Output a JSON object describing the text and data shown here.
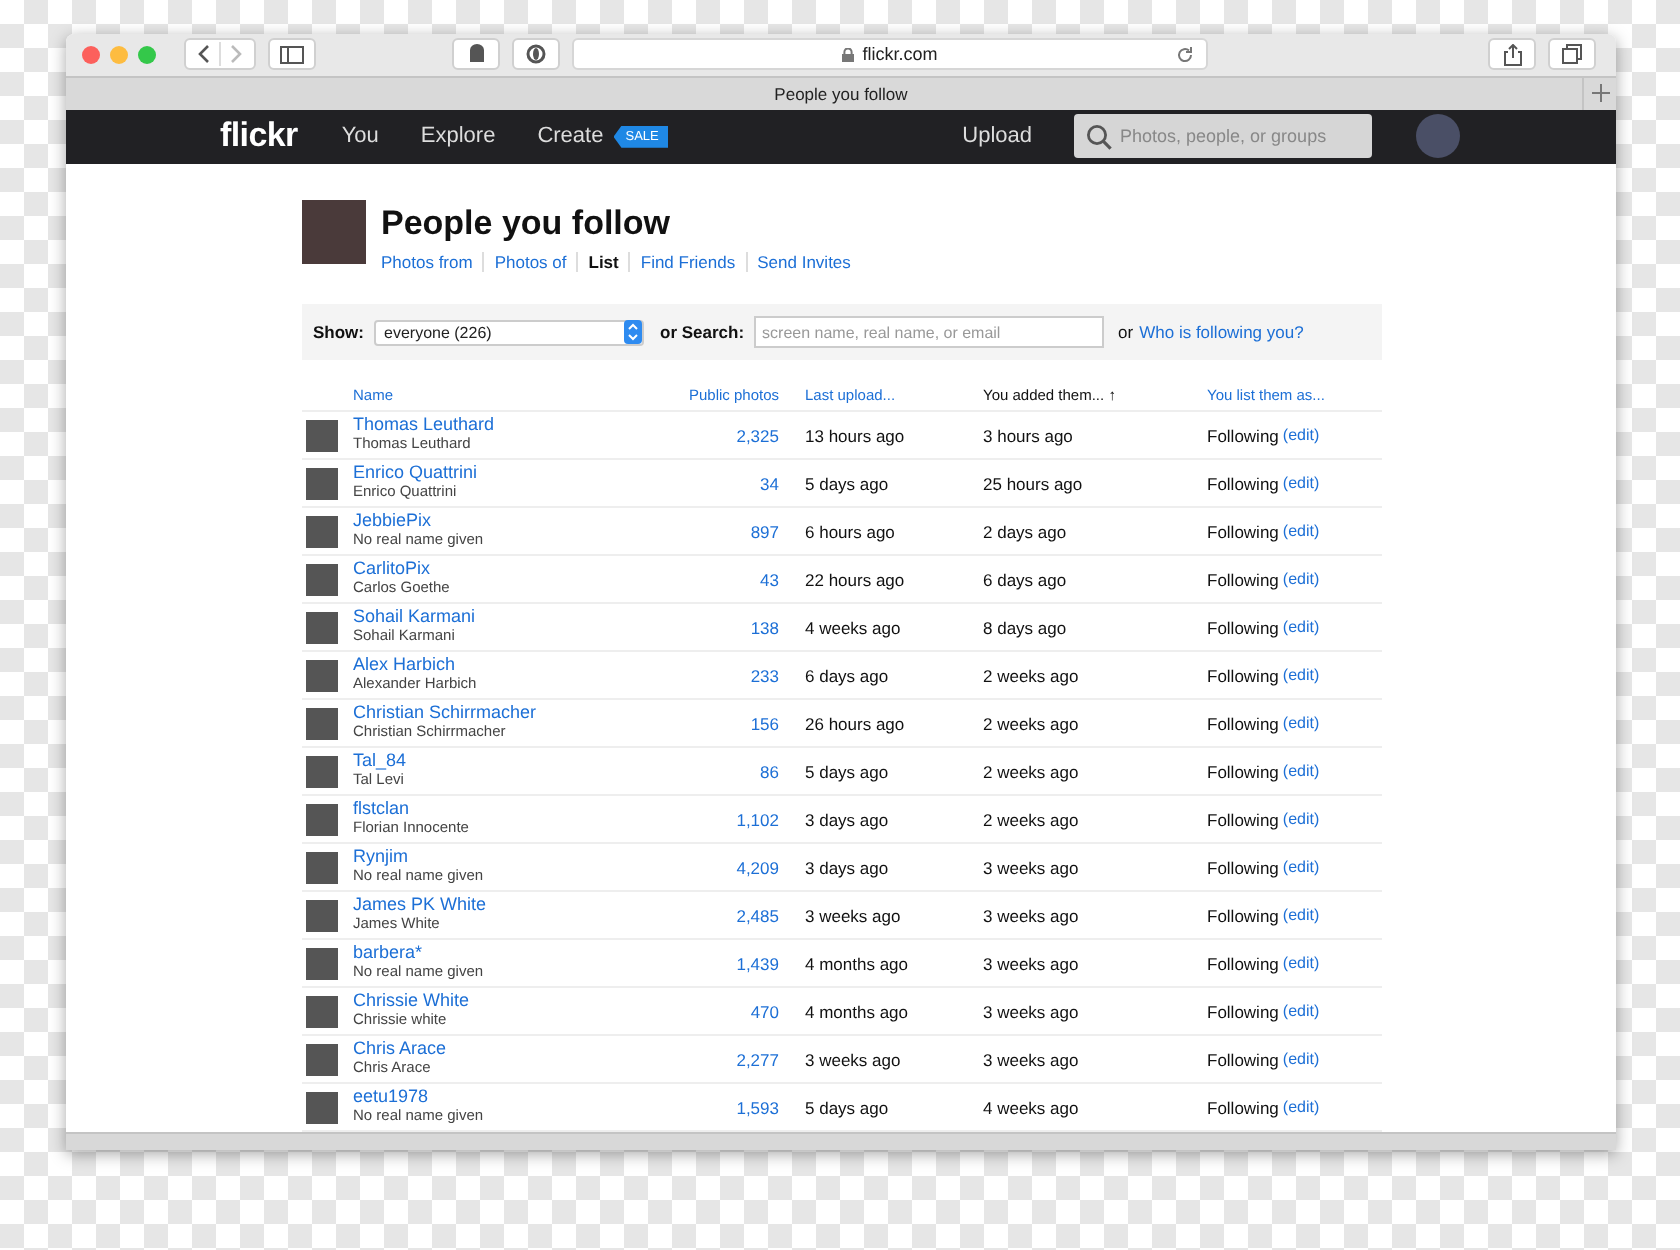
{
  "browser": {
    "url": "flickr.com",
    "tab_title": "People you follow"
  },
  "nav": {
    "logo": "flickr",
    "links": [
      "You",
      "Explore",
      "Create"
    ],
    "badge": "SALE",
    "upload": "Upload",
    "search_placeholder": "Photos, people, or groups"
  },
  "page": {
    "title": "People you follow",
    "tabs": [
      {
        "label": "Photos from",
        "selected": false
      },
      {
        "label": "Photos of",
        "selected": false
      },
      {
        "label": "List",
        "selected": true
      },
      {
        "label": "Find Friends",
        "selected": false
      },
      {
        "label": "Send Invites",
        "selected": false
      }
    ]
  },
  "filter": {
    "show_label": "Show:",
    "select_value": "everyone (226)",
    "search_label": "or Search:",
    "search_placeholder": "screen name, real name, or email",
    "or_text": "or",
    "who_link": "Who is following you?"
  },
  "table": {
    "columns": [
      {
        "label": "Name",
        "selected": false
      },
      {
        "label": "Public photos",
        "selected": false
      },
      {
        "label": "Last upload...",
        "selected": false
      },
      {
        "label": "You added them... ↑",
        "selected": true
      },
      {
        "label": "You list them as...",
        "selected": false
      }
    ],
    "rows": [
      {
        "screen_name": "Thomas Leuthard",
        "real_name": "Thomas Leuthard",
        "photos": "2,325",
        "last_upload": "13 hours ago",
        "added": "3 hours ago",
        "status": "Following",
        "edit": "(edit)"
      },
      {
        "screen_name": "Enrico Quattrini",
        "real_name": "Enrico Quattrini",
        "photos": "34",
        "last_upload": "5 days ago",
        "added": "25 hours ago",
        "status": "Following",
        "edit": "(edit)"
      },
      {
        "screen_name": "JebbiePix",
        "real_name": "No real name given",
        "photos": "897",
        "last_upload": "6 hours ago",
        "added": "2 days ago",
        "status": "Following",
        "edit": "(edit)"
      },
      {
        "screen_name": "CarlitoPix",
        "real_name": "Carlos Goethe",
        "photos": "43",
        "last_upload": "22 hours ago",
        "added": "6 days ago",
        "status": "Following",
        "edit": "(edit)"
      },
      {
        "screen_name": "Sohail Karmani",
        "real_name": "Sohail Karmani",
        "photos": "138",
        "last_upload": "4 weeks ago",
        "added": "8 days ago",
        "status": "Following",
        "edit": "(edit)"
      },
      {
        "screen_name": "Alex Harbich",
        "real_name": "Alexander Harbich",
        "photos": "233",
        "last_upload": "6 days ago",
        "added": "2 weeks ago",
        "status": "Following",
        "edit": "(edit)"
      },
      {
        "screen_name": "Christian Schirrmacher",
        "real_name": "Christian Schirrmacher",
        "photos": "156",
        "last_upload": "26 hours ago",
        "added": "2 weeks ago",
        "status": "Following",
        "edit": "(edit)"
      },
      {
        "screen_name": "Tal_84",
        "real_name": "Tal Levi",
        "photos": "86",
        "last_upload": "5 days ago",
        "added": "2 weeks ago",
        "status": "Following",
        "edit": "(edit)"
      },
      {
        "screen_name": "flstclan",
        "real_name": "Florian Innocente",
        "photos": "1,102",
        "last_upload": "3 days ago",
        "added": "2 weeks ago",
        "status": "Following",
        "edit": "(edit)"
      },
      {
        "screen_name": "Rynjim",
        "real_name": "No real name given",
        "photos": "4,209",
        "last_upload": "3 days ago",
        "added": "3 weeks ago",
        "status": "Following",
        "edit": "(edit)"
      },
      {
        "screen_name": "James PK White",
        "real_name": "James White",
        "photos": "2,485",
        "last_upload": "3 weeks ago",
        "added": "3 weeks ago",
        "status": "Following",
        "edit": "(edit)"
      },
      {
        "screen_name": "barbera*",
        "real_name": "No real name given",
        "photos": "1,439",
        "last_upload": "4 months ago",
        "added": "3 weeks ago",
        "status": "Following",
        "edit": "(edit)"
      },
      {
        "screen_name": "Chrissie White",
        "real_name": "Chrissie white",
        "photos": "470",
        "last_upload": "4 months ago",
        "added": "3 weeks ago",
        "status": "Following",
        "edit": "(edit)"
      },
      {
        "screen_name": "Chris Arace",
        "real_name": "Chris Arace",
        "photos": "2,277",
        "last_upload": "3 weeks ago",
        "added": "3 weeks ago",
        "status": "Following",
        "edit": "(edit)"
      },
      {
        "screen_name": "eetu1978",
        "real_name": "No real name given",
        "photos": "1,593",
        "last_upload": "5 days ago",
        "added": "4 weeks ago",
        "status": "Following",
        "edit": "(edit)"
      }
    ]
  }
}
